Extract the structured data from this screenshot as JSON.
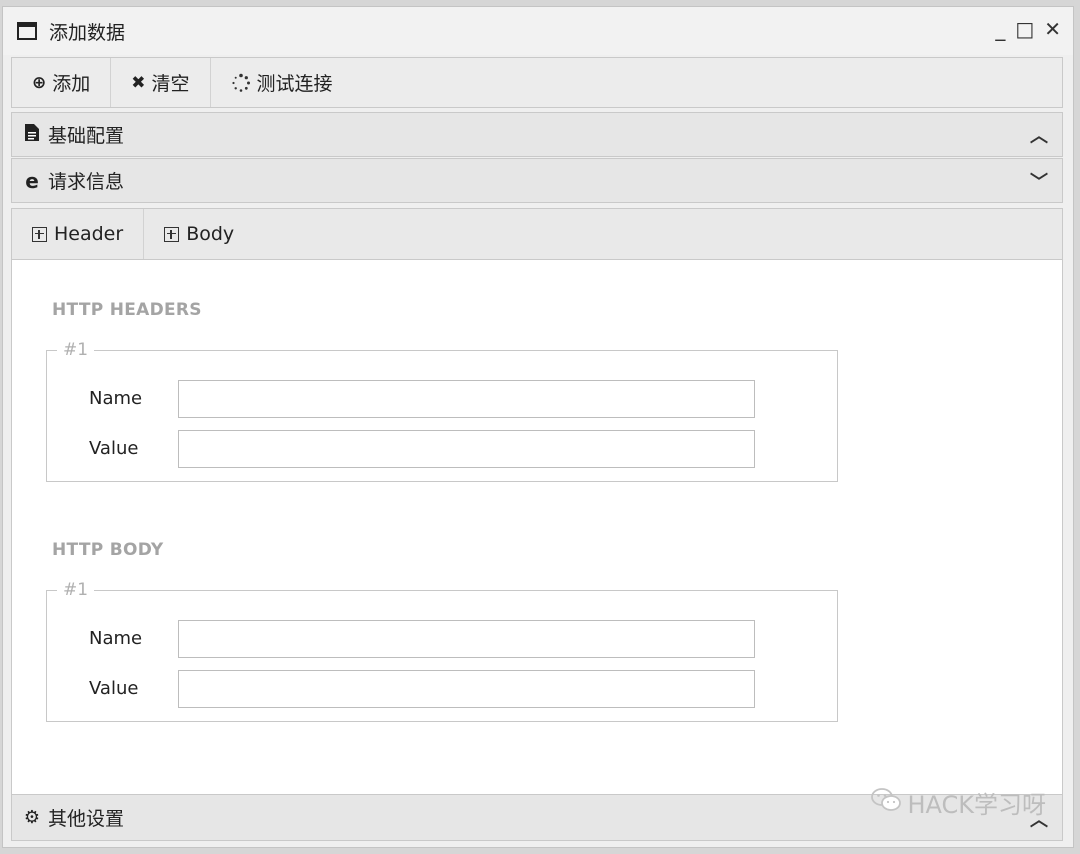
{
  "window": {
    "title": "添加数据",
    "controls": {
      "minimize": "_",
      "maximize": "□",
      "close": "✕"
    }
  },
  "toolbar": {
    "add_label": "添加",
    "clear_label": "清空",
    "test_label": "测试连接"
  },
  "sections": {
    "basic": {
      "label": "基础配置",
      "state": "collapsed"
    },
    "request": {
      "label": "请求信息",
      "state": "expanded"
    },
    "other": {
      "label": "其他设置",
      "state": "collapsed"
    }
  },
  "request": {
    "tabs": {
      "header_label": "Header",
      "body_label": "Body"
    },
    "headers": {
      "title": "HTTP HEADERS",
      "group_label": "#1",
      "name_label": "Name",
      "name_value": "",
      "value_label": "Value",
      "value_value": ""
    },
    "body": {
      "title": "HTTP BODY",
      "group_label": "#1",
      "name_label": "Name",
      "name_value": "",
      "value_label": "Value",
      "value_value": ""
    }
  },
  "watermark": {
    "text": "HACK学习呀",
    "icon": "wechat-icon"
  }
}
